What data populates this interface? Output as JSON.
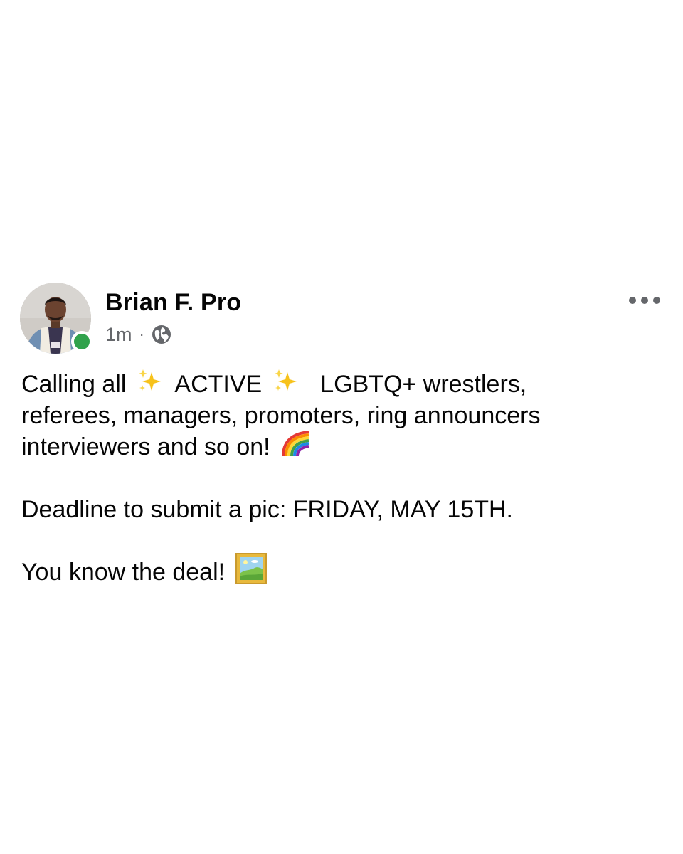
{
  "author": {
    "name": "Brian F. Pro",
    "avatar_icon": "profile-photo",
    "online": true,
    "online_color": "#31a24c"
  },
  "meta": {
    "time": "1m",
    "separator": "·",
    "privacy_icon": "globe-icon"
  },
  "menu": {
    "icon": "more-options-icon"
  },
  "post": {
    "line1_a": "Calling all",
    "line1_b": "ACTIVE",
    "line1_c": "LGBTQ+ wrestlers,",
    "line2": "referees, managers, promoters, ring announcers",
    "line3": "interviewers and so on!",
    "deadline": "Deadline to submit a pic: FRIDAY, MAY 15TH.",
    "closing": "You know the deal!",
    "emojis": [
      "sparkles-icon",
      "rainbow-icon",
      "framed-picture-icon"
    ]
  },
  "colors": {
    "text": "#050505",
    "secondary_text": "#65676b",
    "background": "#ffffff"
  }
}
